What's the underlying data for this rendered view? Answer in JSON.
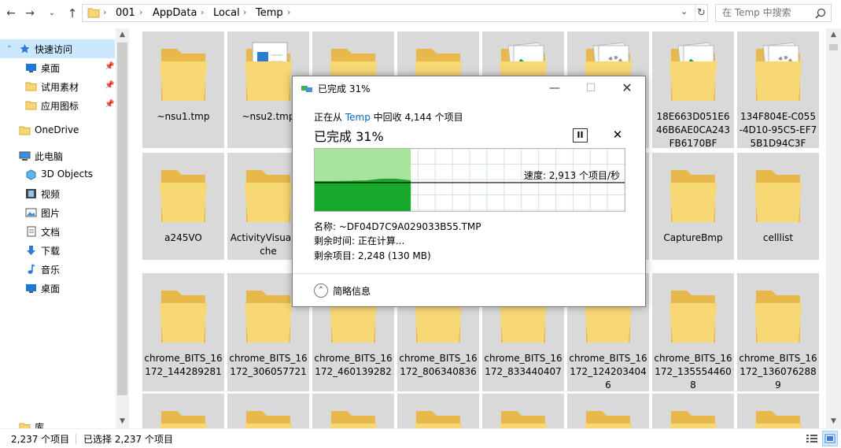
{
  "addressbar": {
    "crumbs": [
      "001",
      "AppData",
      "Local",
      "Temp"
    ],
    "search_placeholder": "在 Temp 中搜索"
  },
  "sidebar": {
    "items": [
      {
        "label": "快速访问",
        "icon": "star-icon"
      },
      {
        "label": "桌面",
        "icon": "desktop-icon"
      },
      {
        "label": "试用素材",
        "icon": "folder-icon"
      },
      {
        "label": "应用图标",
        "icon": "folder-icon"
      },
      {
        "label": "OneDrive",
        "icon": "folder-icon"
      },
      {
        "label": "此电脑",
        "icon": "computer-icon"
      },
      {
        "label": "3D Objects",
        "icon": "cube-icon"
      },
      {
        "label": "视频",
        "icon": "video-icon"
      },
      {
        "label": "图片",
        "icon": "picture-icon"
      },
      {
        "label": "文档",
        "icon": "document-icon"
      },
      {
        "label": "下载",
        "icon": "download-icon"
      },
      {
        "label": "音乐",
        "icon": "music-icon"
      },
      {
        "label": "桌面",
        "icon": "desktop-icon"
      },
      {
        "label": "库",
        "icon": "library-icon"
      }
    ]
  },
  "files": [
    {
      "name": "~nsu1.tmp",
      "kind": "folder"
    },
    {
      "name": "~nsu2.tmp",
      "kind": "doc-folder"
    },
    {
      "name": "",
      "kind": "folder"
    },
    {
      "name": "",
      "kind": "folder"
    },
    {
      "name": "",
      "kind": "arrow-folder"
    },
    {
      "name": "",
      "kind": "gear-folder"
    },
    {
      "name": "18E663D051E646B6AE0CA243FB6170BF",
      "kind": "arrow-folder"
    },
    {
      "name": "134F804E-C055-4D10-95C5-EF75B1D94C3F",
      "kind": "gear-folder"
    },
    {
      "name": "a245VO",
      "kind": "folder"
    },
    {
      "name": "ActivityVisualCache",
      "kind": "folder"
    },
    {
      "name": "",
      "kind": "folder"
    },
    {
      "name": "",
      "kind": "folder"
    },
    {
      "name": "",
      "kind": "folder"
    },
    {
      "name": "",
      "kind": "folder"
    },
    {
      "name": "CaptureBmp",
      "kind": "folder"
    },
    {
      "name": "celllist",
      "kind": "folder"
    },
    {
      "name": "chrome_BITS_16172_144289281",
      "kind": "folder"
    },
    {
      "name": "chrome_BITS_16172_306057721",
      "kind": "folder"
    },
    {
      "name": "chrome_BITS_16172_460139282",
      "kind": "folder"
    },
    {
      "name": "chrome_BITS_16172_806340836",
      "kind": "folder"
    },
    {
      "name": "chrome_BITS_16172_833440407",
      "kind": "folder"
    },
    {
      "name": "chrome_BITS_16172_1242034046",
      "kind": "folder"
    },
    {
      "name": "chrome_BITS_16172_1355544608",
      "kind": "folder"
    },
    {
      "name": "chrome_BITS_16172_1360762889",
      "kind": "folder"
    }
  ],
  "status": {
    "count": "2,237 个项目",
    "selected": "已选择 2,237 个项目"
  },
  "dialog": {
    "title": "已完成 31%",
    "from_prefix": "正在从 ",
    "from_link": "Temp",
    "from_suffix": " 中回收 4,144 个项目",
    "percent_label": "已完成 31%",
    "progress": 0.31,
    "speed": "速度: 2,913 个项目/秒",
    "name": "名称: ~DF04D7C9A029033B55.TMP",
    "time_left": "剩余时间: 正在计算...",
    "items_left": "剩余项目: 2,248 (130 MB)",
    "details_toggle": "简略信息"
  }
}
